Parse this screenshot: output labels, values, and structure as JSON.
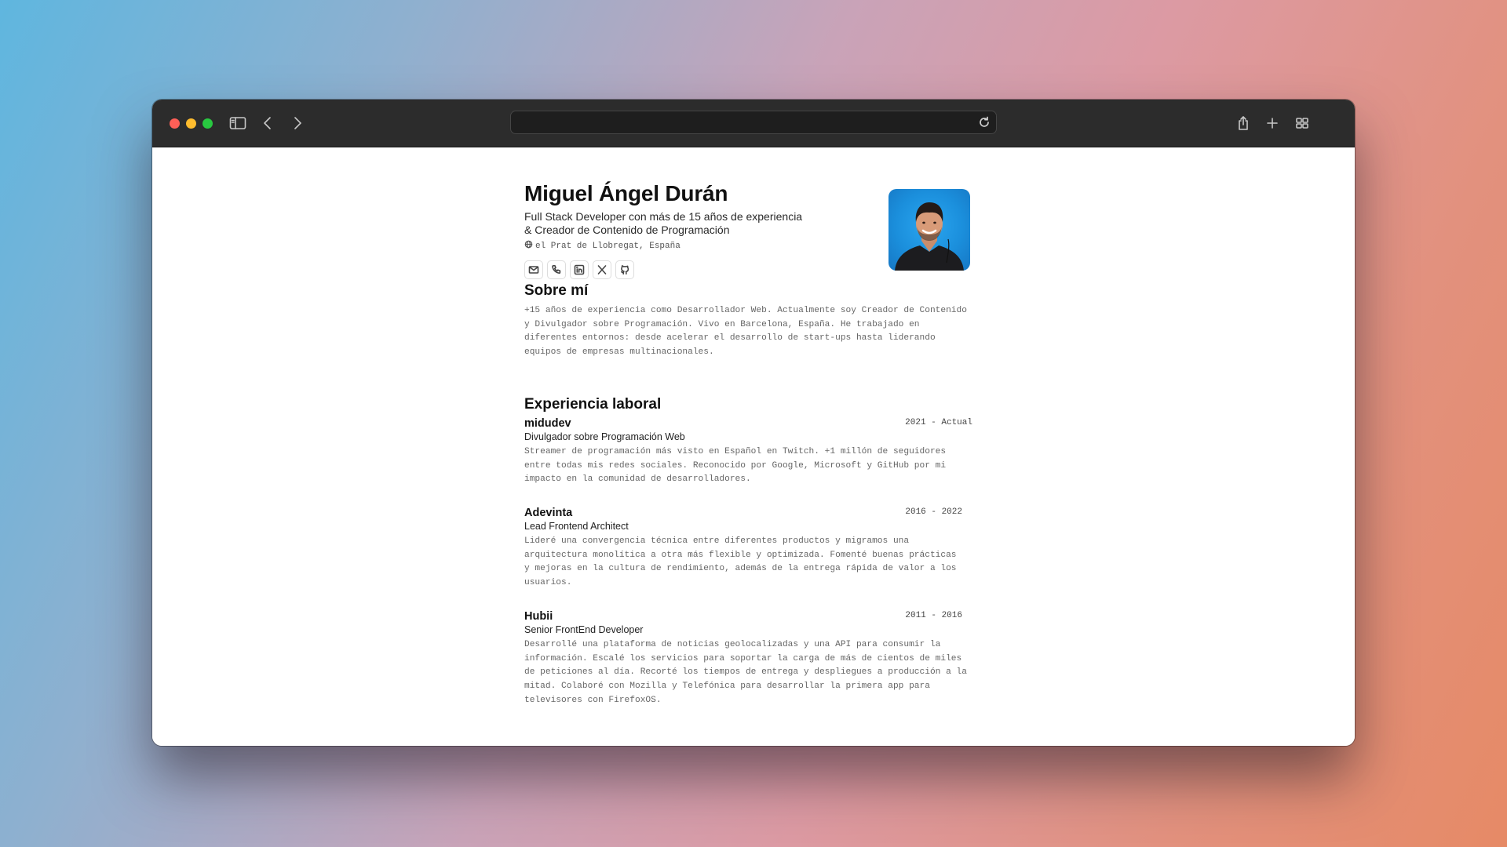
{
  "browser": {
    "url": "",
    "icons": [
      "sidebar-icon",
      "back-icon",
      "forward-icon",
      "reload-icon",
      "share-icon",
      "new-tab-icon",
      "tab-overview-icon"
    ]
  },
  "profile": {
    "name": "Miguel Ángel Durán",
    "tagline": "Full Stack Developer con más de 15 años de experiencia & Creador de Contenido de Programación",
    "location": "el Prat de Llobregat, España",
    "socials": [
      "mail-icon",
      "phone-icon",
      "linkedin-icon",
      "x-icon",
      "github-icon"
    ]
  },
  "about": {
    "title": "Sobre mí",
    "text": "+15 años de experiencia como Desarrollador Web. Actualmente soy Creador de Contenido y Divulgador sobre Programación. Vivo en Barcelona, España. He trabajado en diferentes entornos: desde acelerar el desarrollo de start-ups hasta liderando equipos de empresas multinacionales."
  },
  "experience": {
    "title": "Experiencia laboral",
    "jobs": [
      {
        "company": "midudev",
        "dates": "2021 - Actual",
        "role": "Divulgador sobre Programación Web",
        "description": "Streamer de programación más visto en Español en Twitch. +1 millón de seguidores entre todas mis redes sociales. Reconocido por Google, Microsoft y GitHub por mi impacto en la comunidad de desarrolladores."
      },
      {
        "company": "Adevinta",
        "dates": "2016 - 2022",
        "role": "Lead Frontend Architect",
        "description": "Lideré una convergencia técnica entre diferentes productos y migramos una arquitectura monolítica a otra más flexible y optimizada. Fomenté buenas prácticas y mejoras en la cultura de rendimiento, además de la entrega rápida de valor a los usuarios."
      },
      {
        "company": "Hubii",
        "dates": "2011 - 2016",
        "role": "Senior FrontEnd Developer",
        "description": "Desarrollé una plataforma de noticias geolocalizadas y una API para consumir la información. Escalé los servicios para soportar la carga de más de cientos de miles de peticiones al día. Recorté los tiempos de entrega y despliegues a producción a la mitad. Colaboré con Mozilla y Telefónica para desarrollar la primera app para televisores con FirefoxOS."
      }
    ]
  }
}
